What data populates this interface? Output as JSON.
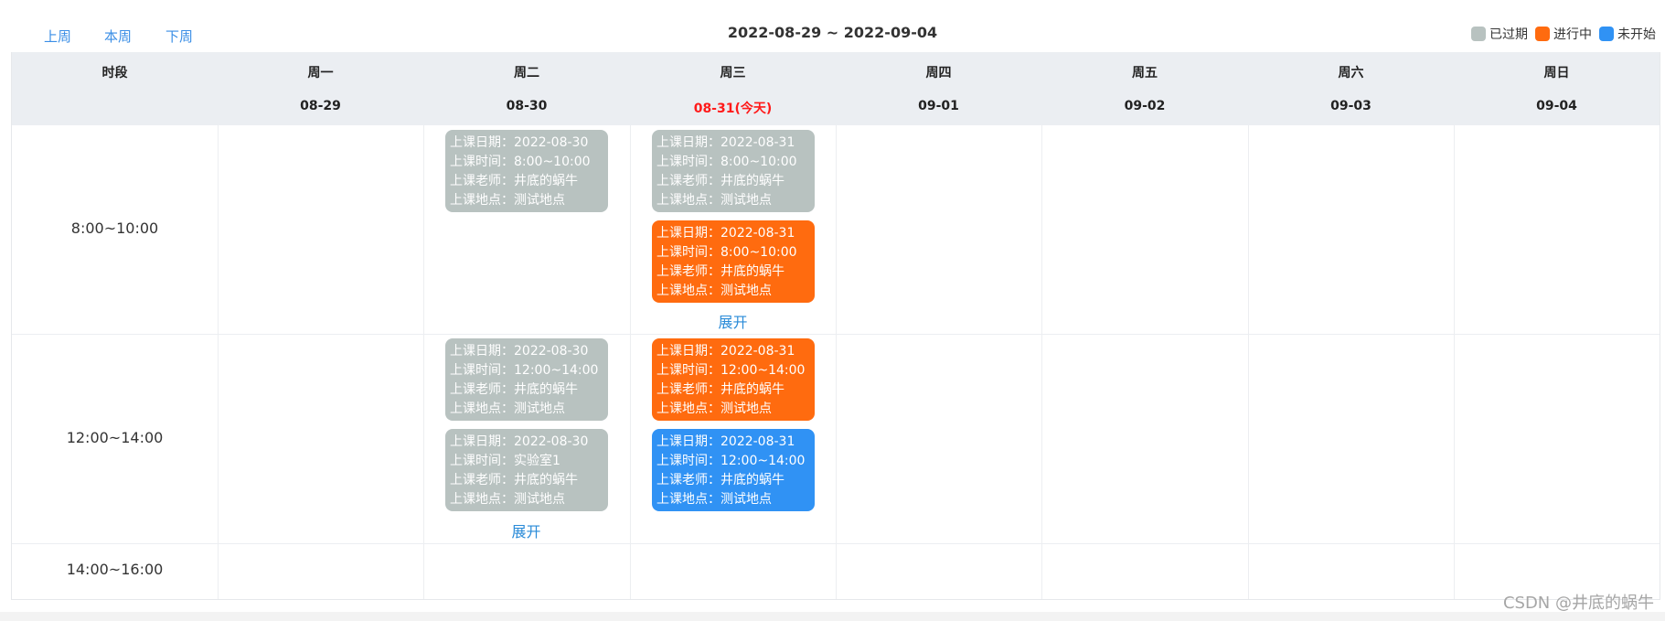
{
  "nav": {
    "prev": "上周",
    "current": "本周",
    "next": "下周"
  },
  "range_title": "2022-08-29 ~ 2022-09-04",
  "legend": [
    {
      "label": "已过期",
      "color": "#b8c2c0"
    },
    {
      "label": "进行中",
      "color": "#ff6b0f"
    },
    {
      "label": "未开始",
      "color": "#3092f4"
    }
  ],
  "header": {
    "slot_title": "时段",
    "days": [
      {
        "weekday": "周一",
        "date": "08-29"
      },
      {
        "weekday": "周二",
        "date": "08-30"
      },
      {
        "weekday": "周三",
        "date": "08-31(今天)"
      },
      {
        "weekday": "周四",
        "date": "09-01"
      },
      {
        "weekday": "周五",
        "date": "09-02"
      },
      {
        "weekday": "周六",
        "date": "09-03"
      },
      {
        "weekday": "周日",
        "date": "09-04"
      }
    ]
  },
  "slots": [
    "8:00~10:00",
    "12:00~14:00",
    "14:00~16:00"
  ],
  "field_labels": {
    "date": "上课日期：",
    "time": "上课时间：",
    "teacher": "上课老师：",
    "place": "上课地点："
  },
  "cards": [
    {
      "slot": 0,
      "day": 1,
      "idx": 0,
      "status": "expired",
      "date": "2022-08-30",
      "time": "8:00~10:00",
      "teacher": "井底的蜗牛",
      "place": "测试地点"
    },
    {
      "slot": 0,
      "day": 2,
      "idx": 0,
      "status": "expired",
      "date": "2022-08-31",
      "time": "8:00~10:00",
      "teacher": "井底的蜗牛",
      "place": "测试地点"
    },
    {
      "slot": 0,
      "day": 2,
      "idx": 1,
      "status": "ongoing",
      "date": "2022-08-31",
      "time": "8:00~10:00",
      "teacher": "井底的蜗牛",
      "place": "测试地点"
    },
    {
      "slot": 1,
      "day": 1,
      "idx": 0,
      "status": "expired",
      "date": "2022-08-30",
      "time": "12:00~14:00",
      "teacher": "井底的蜗牛",
      "place": "测试地点"
    },
    {
      "slot": 1,
      "day": 1,
      "idx": 1,
      "status": "expired",
      "date": "2022-08-30",
      "time": "实验室1",
      "teacher": "井底的蜗牛",
      "place": "测试地点"
    },
    {
      "slot": 1,
      "day": 2,
      "idx": 0,
      "status": "ongoing",
      "date": "2022-08-31",
      "time": "12:00~14:00",
      "teacher": "井底的蜗牛",
      "place": "测试地点"
    },
    {
      "slot": 1,
      "day": 2,
      "idx": 1,
      "status": "upcoming",
      "date": "2022-08-31",
      "time": "12:00~14:00",
      "teacher": "井底的蜗牛",
      "place": "测试地点"
    }
  ],
  "status_colors": {
    "expired": "#b8c2c0",
    "ongoing": "#ff6b0f",
    "upcoming": "#3092f4"
  },
  "expand_label": "展开",
  "expand_links": [
    {
      "slot": 0,
      "day": 2
    },
    {
      "slot": 1,
      "day": 1
    }
  ],
  "watermark": "CSDN @井底的蜗牛"
}
